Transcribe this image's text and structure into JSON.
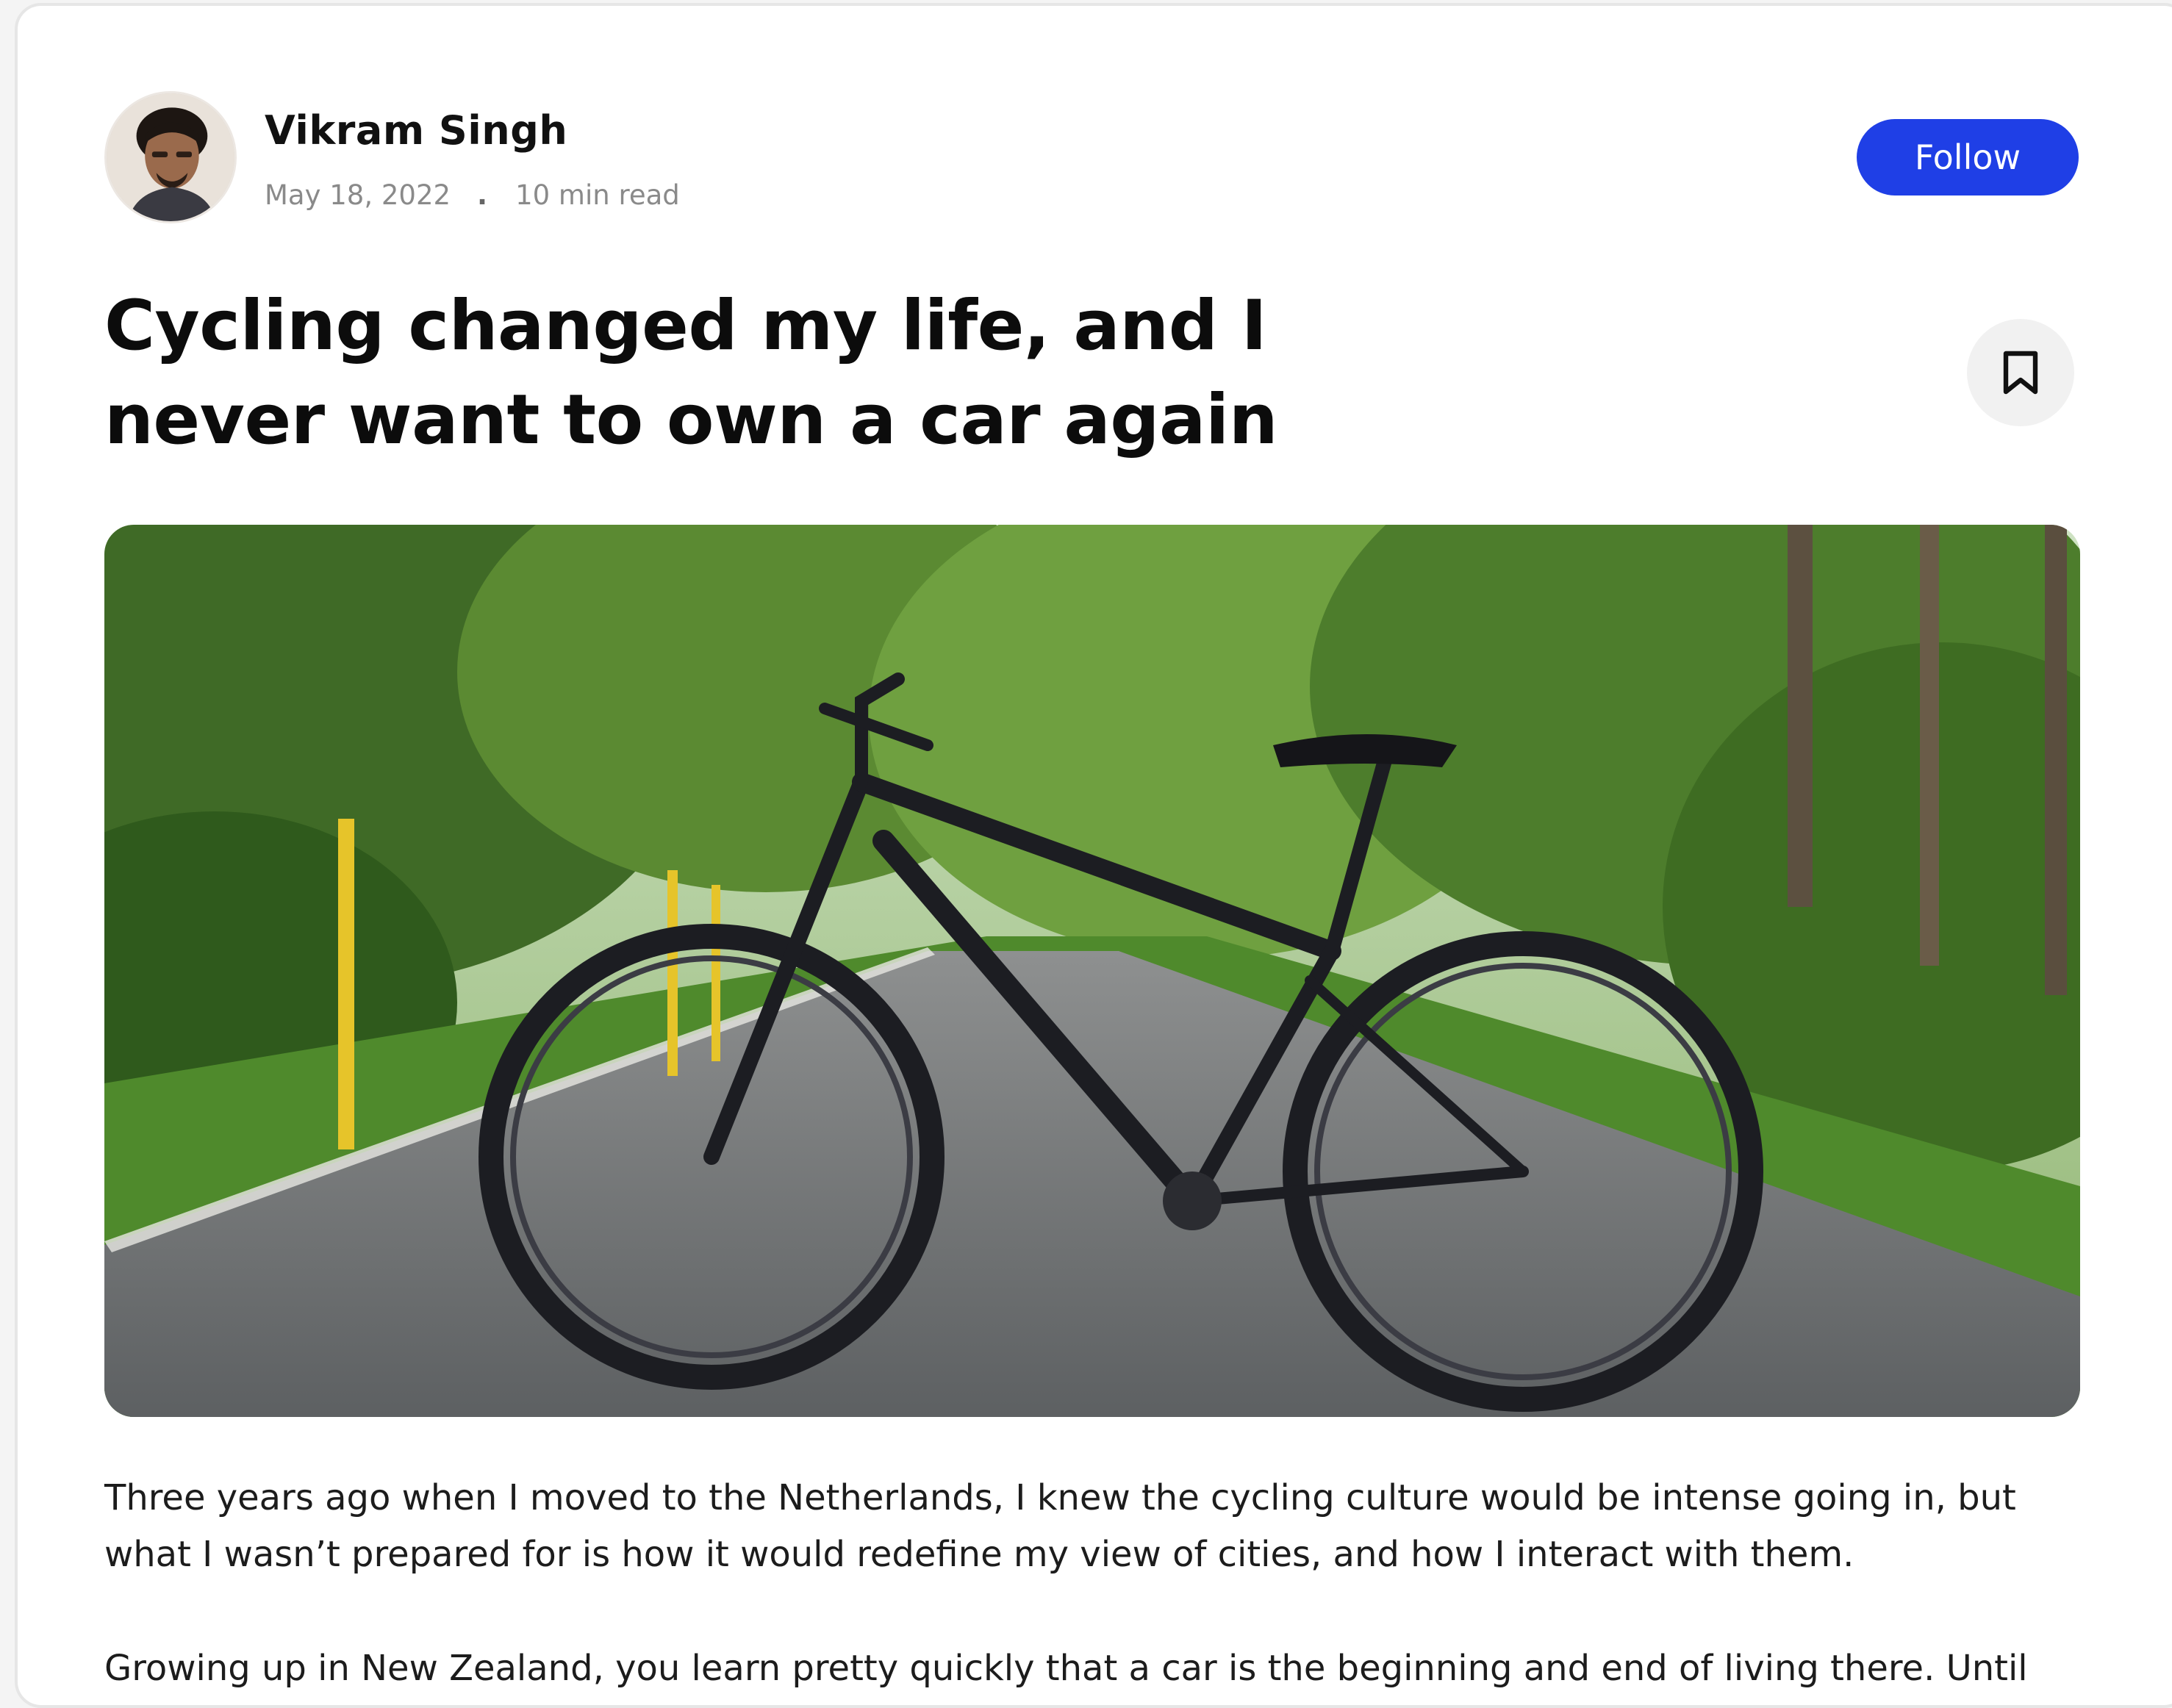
{
  "author": {
    "name": "Vikram Singh",
    "date": "May 18, 2022",
    "separator": ".",
    "read_time": "10 min read"
  },
  "follow_label": "Follow",
  "article": {
    "title": "Cycling changed my life, and I never want to own a car again",
    "paragraphs": [
      "Three years ago when I moved to the Netherlands, I knew the cycling culture would be intense going in, but what I wasn’t prepared for is how it would redefine my view of cities, and how I interact with them.",
      "Growing up in New Zealand, you learn pretty quickly that a car is the beginning and end of living there. Until"
    ]
  },
  "icons": {
    "bookmark": "bookmark-icon"
  },
  "colors": {
    "accent": "#1f3fe6",
    "meta_text": "#8a8a8a",
    "bookmark_bg": "#f1f1f1"
  }
}
